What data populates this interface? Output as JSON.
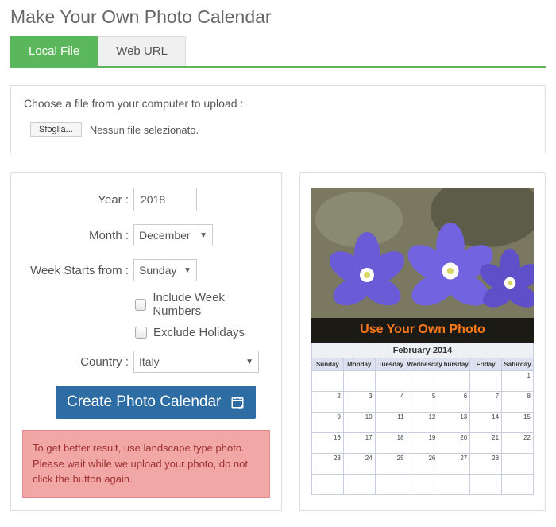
{
  "title": "Make Your Own Photo Calendar",
  "tabs": {
    "local": "Local File",
    "web": "Web URL"
  },
  "upload": {
    "label": "Choose a file from your computer to upload :",
    "browse": "Sfoglia...",
    "status": "Nessun file selezionato."
  },
  "form": {
    "year_label": "Year :",
    "year_value": "2018",
    "month_label": "Month :",
    "month_value": "December",
    "week_label": "Week Starts from :",
    "week_value": "Sunday",
    "include_wn": "Include Week Numbers",
    "exclude_hol": "Exclude Holidays",
    "country_label": "Country :",
    "country_value": "Italy",
    "submit": "Create Photo Calendar"
  },
  "alert": "To get better result, use landscape type photo. Please wait while we upload your photo, do not click the button again.",
  "preview": {
    "banner": "Use Your Own Photo",
    "month_title": "February 2014",
    "dows": [
      "Sunday",
      "Monday",
      "Tuesday",
      "Wednesday",
      "Thursday",
      "Friday",
      "Saturday"
    ],
    "grid": [
      [
        "",
        "",
        "",
        "",
        "",
        "",
        "1"
      ],
      [
        "2",
        "3",
        "4",
        "5",
        "6",
        "7",
        "8"
      ],
      [
        "9",
        "10",
        "11",
        "12",
        "13",
        "14",
        "15"
      ],
      [
        "16",
        "17",
        "18",
        "19",
        "20",
        "21",
        "22"
      ],
      [
        "23",
        "24",
        "25",
        "26",
        "27",
        "28",
        ""
      ],
      [
        "",
        "",
        "",
        "",
        "",
        "",
        ""
      ]
    ]
  }
}
